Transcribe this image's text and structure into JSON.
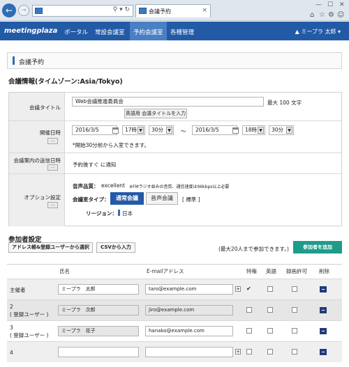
{
  "browser": {
    "address_value": "",
    "address_icons": "⚲ ▾ ↻",
    "tab_title": "会議予約",
    "tab_close": "×",
    "window_controls": [
      "—",
      "☐",
      "✕"
    ],
    "tools_icons": [
      "⌂",
      "☆",
      "⚙",
      "☺"
    ]
  },
  "nav": {
    "logo": "meetingplaza",
    "items": [
      "ポータル",
      "常設会議室",
      "予約会議室",
      "各種管理"
    ],
    "active_index": 2,
    "user": "ミープラ 太郎"
  },
  "page_title": "会議予約",
  "meeting_info": {
    "title": "会議情報(タイムゾーン:Asia/Tokyo)",
    "rows": {
      "title_label": "会議タイトル",
      "title_value": "Web会議推進委員会",
      "title_limit": "最大 100 文字",
      "title_button": "英語用 会議タイトルを入力",
      "datetime_label": "開催日時",
      "mini_button": "...",
      "start_date": "2016/3/5",
      "start_hour": "17時",
      "start_min": "30分",
      "tilde": "〜",
      "end_date": "2016/3/5",
      "end_hour": "18時",
      "end_min": "30分",
      "entry_note": "*開始30分前から入室できます。",
      "notify_label": "会議案内の送信日時",
      "notify_value": "予約後すぐ に通知",
      "option_label": "オプション設定",
      "audio_label": "音声品質：",
      "audio_value": "excellent",
      "audio_note": "※FMラジオ並みの音質、通信速度は96kbps以上必要",
      "room_type_label": "会議室タイプ：",
      "room_type_on": "通常会議",
      "room_type_off": "音声会議",
      "room_type_std": "[ 標準 ]",
      "region_label": "リージョン：",
      "region_value": "日本"
    }
  },
  "participants": {
    "title": "参加者設定",
    "btn_address": "アドレス帳&登録ユーザーから選択",
    "btn_csv": "CSVから入力",
    "limit_note": "(最大20人まで参加できます。)",
    "btn_add": "参加者を追加",
    "headers": [
      "氏名",
      "E-mailアドレス",
      "特権",
      "英語",
      "録画許可",
      "削除"
    ],
    "rows": [
      {
        "label1": "主催者",
        "label2": "",
        "name": "ミープラ　太郎",
        "email": "taro@example.com",
        "privilege": true
      },
      {
        "label1": "2",
        "label2": "( 登録ユーザー )",
        "name": "ミープラ　次郎",
        "email": "jiro@example.com",
        "privilege": false
      },
      {
        "label1": "3",
        "label2": "( 登録ユーザー )",
        "name": "ミープラ　花子",
        "email": "hanako@example.com",
        "privilege": false
      },
      {
        "label1": "4",
        "label2": "",
        "name": "",
        "email": "",
        "privilege": false
      }
    ]
  },
  "colors": {
    "nav": "#235aa6",
    "accent": "#2f6db5",
    "add_button": "#1e9c8a"
  }
}
